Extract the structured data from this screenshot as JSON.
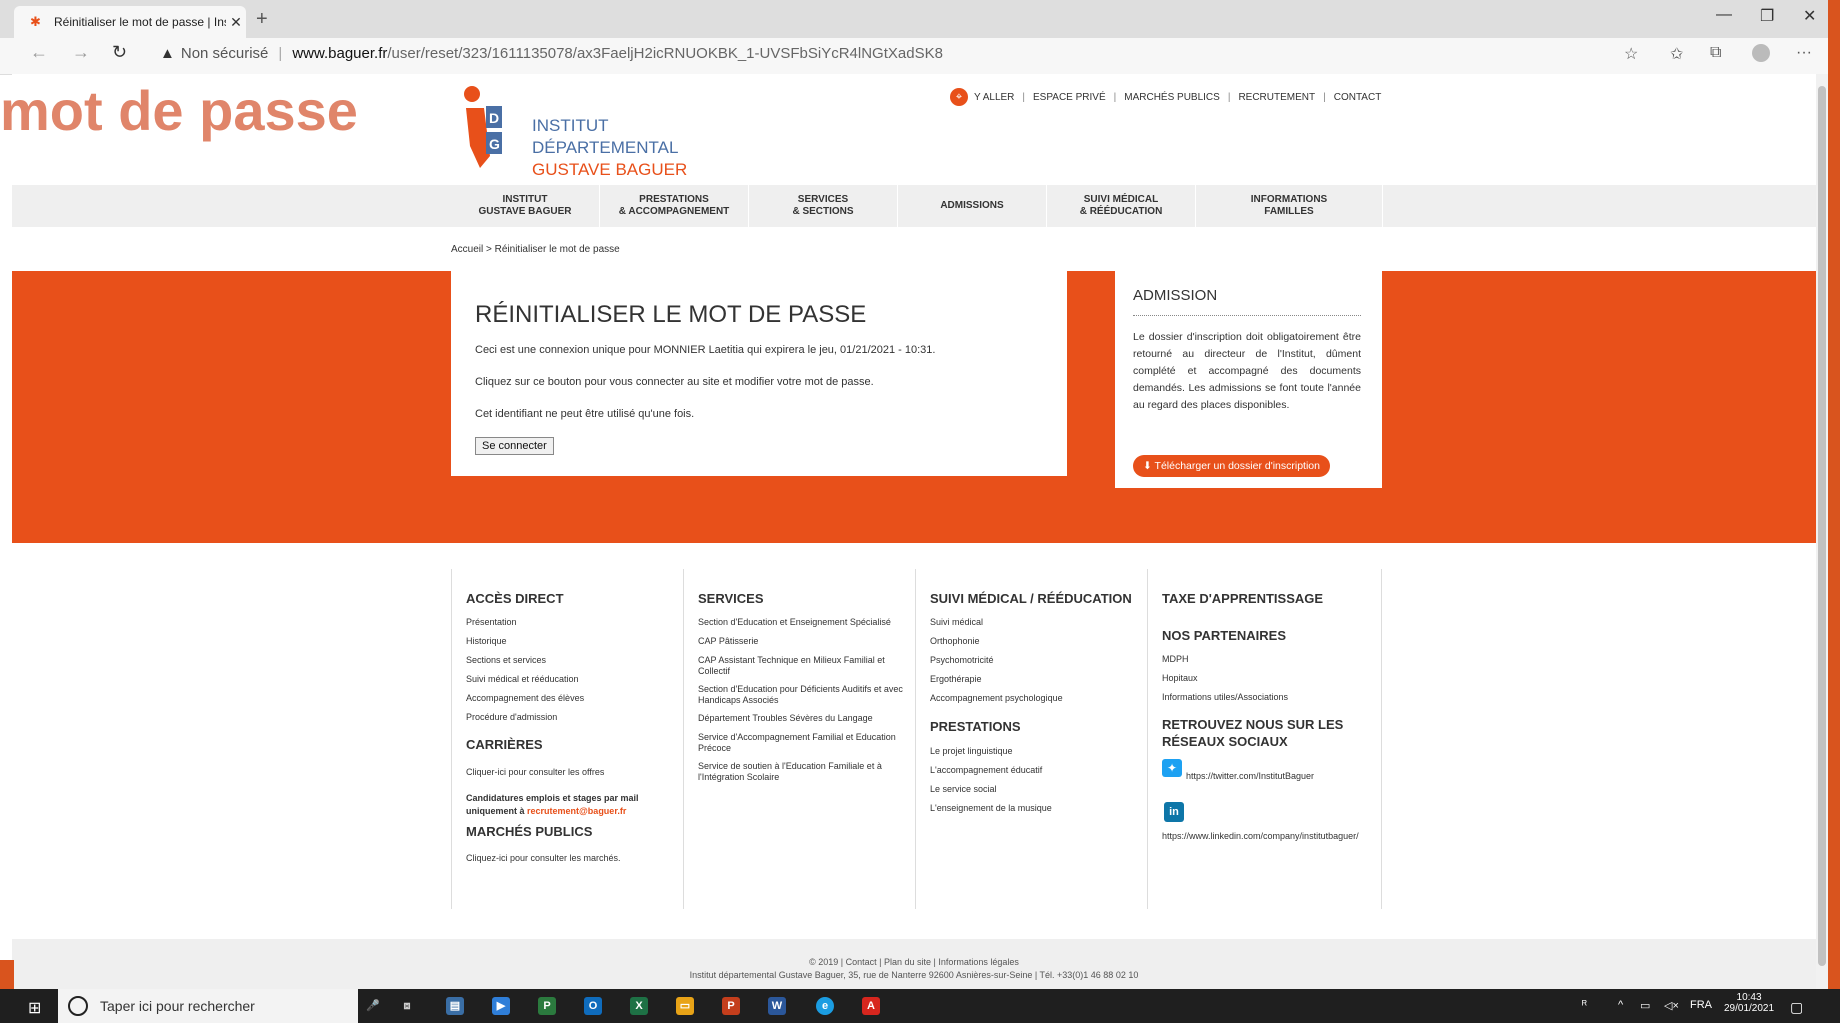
{
  "overlay": {
    "title": "mot de passe"
  },
  "browser": {
    "tab_title": "Réinitialiser le mot de passe | Ins",
    "security_label": "Non sécurisé",
    "url_domain": "www.baguer.fr",
    "url_path": "/user/reset/323/1611135078/ax3FaeljH2icRNUOKBK_1-UVSFbSiYcR4lNGtXadSK8"
  },
  "site": {
    "logo": {
      "line1": "INSTITUT",
      "line2": "DÉPARTEMENTAL",
      "line3": "GUSTAVE BAGUER",
      "letters": "I D G"
    },
    "toplinks": [
      "Y ALLER",
      "ESPACE PRIVÉ",
      "MARCHÉS PUBLICS",
      "RECRUTEMENT",
      "CONTACT"
    ],
    "nav": [
      {
        "l1": "INSTITUT",
        "l2": "GUSTAVE BAGUER"
      },
      {
        "l1": "PRESTATIONS",
        "l2": "& ACCOMPAGNEMENT"
      },
      {
        "l1": "SERVICES",
        "l2": "& SECTIONS"
      },
      {
        "l1": "ADMISSIONS",
        "l2": ""
      },
      {
        "l1": "SUIVI MÉDICAL",
        "l2": "& RÉÉDUCATION"
      },
      {
        "l1": "INFORMATIONS",
        "l2": "FAMILLES"
      }
    ],
    "breadcrumb": "Accueil > Réinitialiser le mot de passe"
  },
  "reset": {
    "heading": "RÉINITIALISER LE MOT DE PASSE",
    "line1": "Ceci est une connexion unique pour MONNIER Laetitia qui expirera le jeu, 01/21/2021 - 10:31.",
    "line2": "Cliquez sur ce bouton pour vous connecter au site et modifier votre mot de passe.",
    "line3": "Cet identifiant ne peut être utilisé qu'une fois.",
    "button": "Se connecter"
  },
  "admission": {
    "heading": "ADMISSION",
    "text": "Le dossier d'inscription doit obligatoirement être retourné au directeur de l'Institut, dûment complété et accompagné des documents demandés. Les admissions se font toute l'année au regard des places disponibles.",
    "download": "Télécharger un dossier d'inscription"
  },
  "footer": {
    "acces": {
      "title": "ACCÈS DIRECT",
      "links": [
        "Présentation",
        "Historique",
        "Sections et services",
        "Suivi médical et rééducation",
        "Accompagnement des élèves",
        "Procédure d'admission"
      ]
    },
    "carrieres": {
      "title": "CARRIÈRES",
      "link": "Cliquer-ici pour consulter les offres",
      "note1": "Candidatures emplois et stages par mail",
      "note2": "uniquement à ",
      "email": "recrutement@baguer.fr"
    },
    "marches": {
      "title": "MARCHÉS PUBLICS",
      "link": "Cliquez-ici pour consulter les marchés."
    },
    "services": {
      "title": "SERVICES",
      "links": [
        "Section d'Education et Enseignement Spécialisé",
        "CAP Pâtisserie",
        "CAP Assistant Technique en Milieux Familial et Collectif",
        "Section d'Education pour Déficients Auditifs et avec Handicaps Associés",
        "Département Troubles Sévères du Langage",
        "Service d'Accompagnement Familial et Education Précoce",
        "Service de soutien à l'Education Familiale et à l'Intégration Scolaire"
      ]
    },
    "suivi": {
      "title": "SUIVI MÉDICAL / RÉÉDUCATION",
      "links": [
        "Suivi médical",
        "Orthophonie",
        "Psychomotricité",
        "Ergothérapie",
        "Accompagnement psychologique"
      ]
    },
    "prestations": {
      "title": "PRESTATIONS",
      "links": [
        "Le projet linguistique",
        "L'accompagnement éducatif",
        "Le service social",
        "L'enseignement de la musique"
      ]
    },
    "taxe": {
      "title": "TAXE D'APPRENTISSAGE"
    },
    "partenaires": {
      "title": "NOS PARTENAIRES",
      "links": [
        "MDPH",
        "Hopitaux",
        "Informations utiles/Associations"
      ]
    },
    "reseaux": {
      "title1": "RETROUVEZ NOUS SUR LES",
      "title2": "RÉSEAUX SOCIAUX",
      "twitter": "https://twitter.com/InstitutBaguer",
      "linkedin": "https://www.linkedin.com/company/institutbaguer/"
    },
    "copyright": "© 2019 | Contact | Plan du site | Informations légales",
    "address": "Institut départemental Gustave Baguer, 35, rue de Nanterre 92600 Asnières-sur-Seine | Tél. +33(0)1 46 88 02 10"
  },
  "taskbar": {
    "search_placeholder": "Taper ici pour rechercher",
    "lang": "FRA",
    "time": "10:43",
    "date": "29/01/2021"
  }
}
